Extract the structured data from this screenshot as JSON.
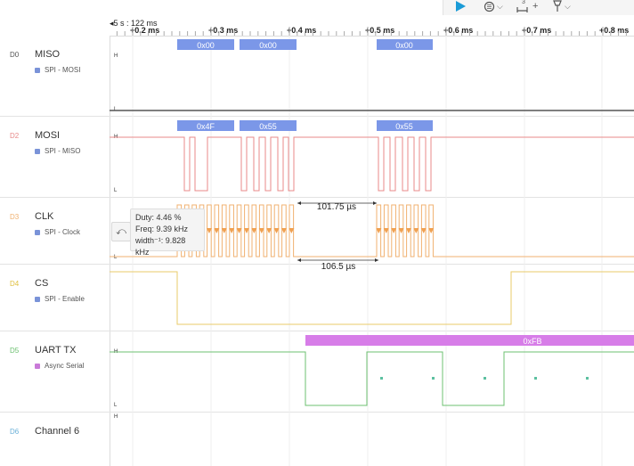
{
  "toolbar": {
    "play_icon": "play-icon",
    "trigger_icon": "trigger-icon",
    "measure_icon": "measure-icon",
    "measure_count": "3",
    "marker_icon": "marker-icon"
  },
  "ruler": {
    "base_time": "5 s : 122 ms",
    "ticks": [
      "+0.2 ms",
      "+0.3 ms",
      "+0.4 ms",
      "+0.5 ms",
      "+0.6 ms",
      "+0.7 ms",
      "+0.8 ms"
    ]
  },
  "channels": [
    {
      "num": "D0",
      "name": "MISO",
      "analyzer": "SPI - MOSI",
      "num_color": "#555555",
      "dot_color": "#7a93d8"
    },
    {
      "num": "D2",
      "name": "MOSI",
      "analyzer": "SPI - MISO",
      "num_color": "#e88a8a",
      "dot_color": "#7a93d8"
    },
    {
      "num": "D3",
      "name": "CLK",
      "analyzer": "SPI - Clock",
      "num_color": "#f0b170",
      "dot_color": "#7a93d8"
    },
    {
      "num": "D4",
      "name": "CS",
      "analyzer": "SPI - Enable",
      "num_color": "#e0c040",
      "dot_color": "#7a93d8"
    },
    {
      "num": "D5",
      "name": "UART TX",
      "analyzer": "Async Serial",
      "num_color": "#6cc070",
      "dot_color": "#c97ad8"
    },
    {
      "num": "D6",
      "name": "Channel 6",
      "analyzer": "",
      "num_color": "#6ab0d8",
      "dot_color": ""
    }
  ],
  "axis": {
    "high": "H",
    "low": "L"
  },
  "decoded": {
    "miso": [
      "0x00",
      "0x00",
      "0x00"
    ],
    "mosi": [
      "0x4F",
      "0x55",
      "0x55"
    ],
    "uart": "0xFB"
  },
  "measurements": {
    "gap_top": "101.75 µs",
    "gap_bottom": "106.5 µs"
  },
  "tooltip": {
    "duty": "Duty: 4.46 %",
    "freq": "Freq: 9.39 kHz",
    "width": "width⁻¹: 9.828 kHz"
  },
  "colors": {
    "spi_box": "#7b97e8",
    "uart_box": "#d77de8",
    "miso": "#555555",
    "mosi": "#e88a8a",
    "clk": "#f0b170",
    "cs": "#eacb6a",
    "uart": "#6cc070"
  }
}
